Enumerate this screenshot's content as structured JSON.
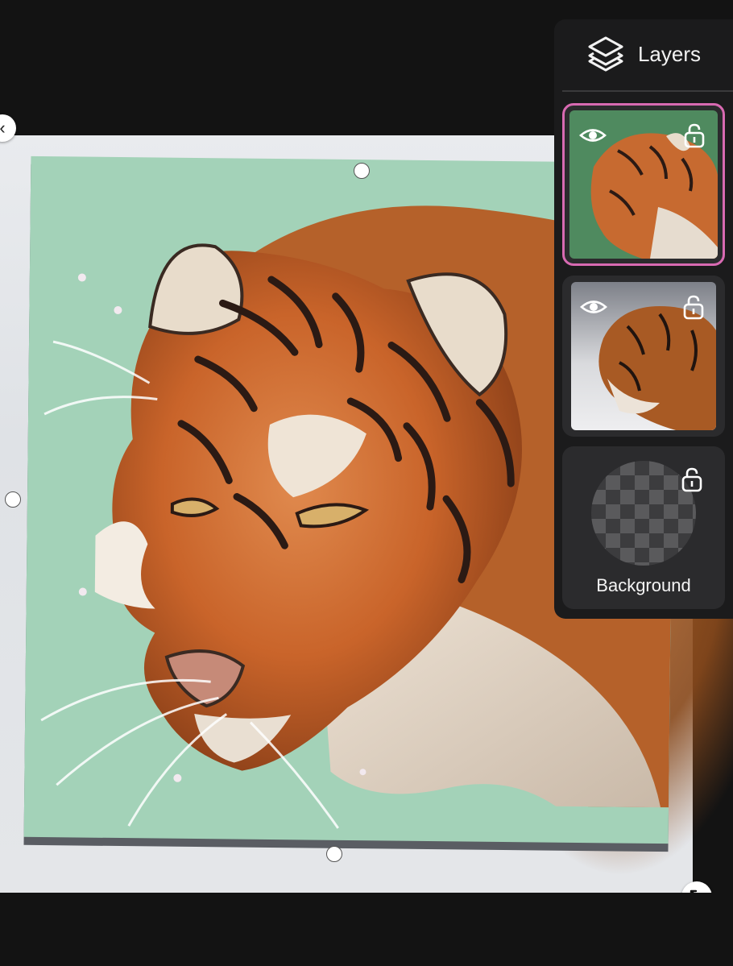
{
  "layers_panel": {
    "title": "Layers",
    "icon": "layers-stack-icon",
    "items": [
      {
        "name": "tiger-drawing-layer",
        "visible": true,
        "locked": false,
        "selected": true
      },
      {
        "name": "tiger-photo-layer",
        "visible": true,
        "locked": false,
        "selected": false
      },
      {
        "name": "background-layer",
        "label": "Background",
        "locked": false,
        "selected": false
      }
    ]
  },
  "colors": {
    "app_background": "#131313",
    "panel_background": "#1b1b1c",
    "card_background": "#2b2b2d",
    "selection_accent": "#d86ab2",
    "art_background": "#a3d2b8"
  },
  "controls": {
    "collapse_icon": "chevron-left-icon",
    "resize_icon": "diagonal-resize-icon"
  }
}
